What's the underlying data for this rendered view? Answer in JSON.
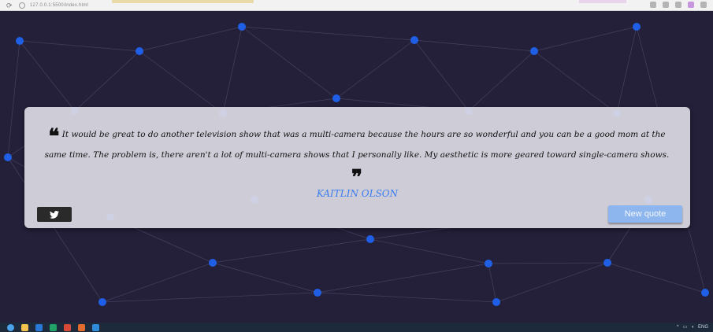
{
  "browser": {
    "url": "127.0.0.1:5500/index.html"
  },
  "quote": {
    "text": "It would be great to do another television show that was a multi-camera because the hours are so wonderful and you can be a good mom at the same time. The problem is, there aren't a lot of multi-camera shows that I personally like. My aesthetic is more geared toward single-camera shows.",
    "open_mark": "❝",
    "close_mark": "❞",
    "author": "KAITLIN OLSON"
  },
  "buttons": {
    "tweet_icon": "twitter-icon",
    "new_quote_label": "New quote"
  },
  "taskbar": {
    "language": "ENG"
  },
  "colors": {
    "background": "#25203a",
    "node": "#1f5fe6",
    "link": "#4a4a6a",
    "author": "#3c7df0",
    "new_quote_button": "#8db6ef"
  }
}
